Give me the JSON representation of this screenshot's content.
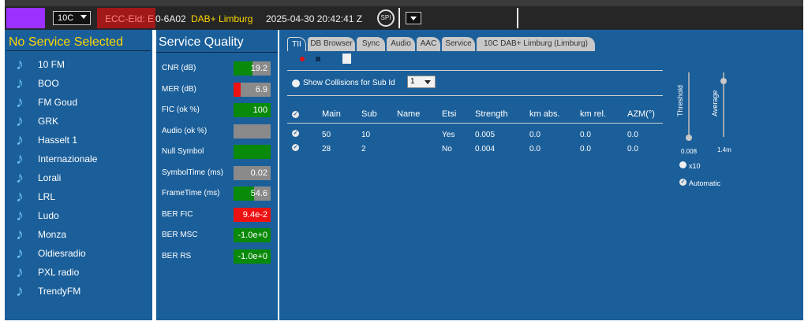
{
  "topbar": {
    "channel": "10C",
    "ecc_label": "ECC-EId: E",
    "ecc_value": "0-6A02",
    "ensemble": "DAB+ Limburg",
    "datetime": "2025-04-30  20:42:41 Z",
    "spi_label": "SPI"
  },
  "services": {
    "header": "No Service Selected",
    "items": [
      "10 FM",
      "BOO",
      "FM Goud",
      "GRK",
      "Hasselt 1",
      "Internazionale",
      "Lorali",
      "LRL",
      "Ludo",
      "Monza",
      "Oldiesradio",
      "PXL radio",
      "TrendyFM"
    ]
  },
  "quality": {
    "title": "Service Quality",
    "rows": [
      {
        "label": "CNR (dB)",
        "value": "19.2",
        "level": 0.52,
        "color": "#0a8a0a"
      },
      {
        "label": "MER (dB)",
        "value": "6.9",
        "level": 0.2,
        "color": "#ee1111"
      },
      {
        "label": "FIC (ok %)",
        "value": "100",
        "level": 1.0,
        "color": "#0a8a0a"
      },
      {
        "label": "Audio (ok %)",
        "value": "",
        "level": 0.0,
        "color": "#0a8a0a"
      },
      {
        "label": "Null Symbol",
        "value": "",
        "level": 1.0,
        "color": "#0a8a0a"
      },
      {
        "label": "SymbolTime (ms)",
        "value": "0.02",
        "level": 0.0,
        "color": "#0a8a0a"
      },
      {
        "label": "FrameTime (ms)",
        "value": "54.6",
        "level": 0.55,
        "color": "#0a8a0a"
      },
      {
        "label": "BER FIC",
        "value": "9.4e-2",
        "level": 1.0,
        "color": "#ee1111"
      },
      {
        "label": "BER MSC",
        "value": "-1.0e+0",
        "level": 1.0,
        "color": "#0a8a0a"
      },
      {
        "label": "BER RS",
        "value": "-1.0e+0",
        "level": 1.0,
        "color": "#0a8a0a"
      }
    ]
  },
  "tabs": [
    "TII",
    "DB Browser",
    "Sync",
    "Audio",
    "AAC",
    "Service",
    "10C DAB+ Limburg (Limburg)"
  ],
  "tii": {
    "show_collisions_label": "Show Collisions for Sub Id",
    "sub_id": "1",
    "columns": [
      "Main",
      "Sub",
      "Name",
      "Etsi",
      "Strength",
      "km abs.",
      "km rel.",
      "AZM(°)"
    ],
    "rows": [
      [
        "50",
        "10",
        "",
        "Yes",
        "0.005",
        "0.0",
        "0.0",
        "0.0"
      ],
      [
        "28",
        "2",
        "",
        "No",
        "0.004",
        "0.0",
        "0.0",
        "0.0"
      ]
    ],
    "threshold_label": "Threshold",
    "threshold_value": "0.008",
    "average_label": "Average",
    "average_value": "1.4m",
    "x10_label": "x10",
    "automatic_label": "Automatic"
  }
}
